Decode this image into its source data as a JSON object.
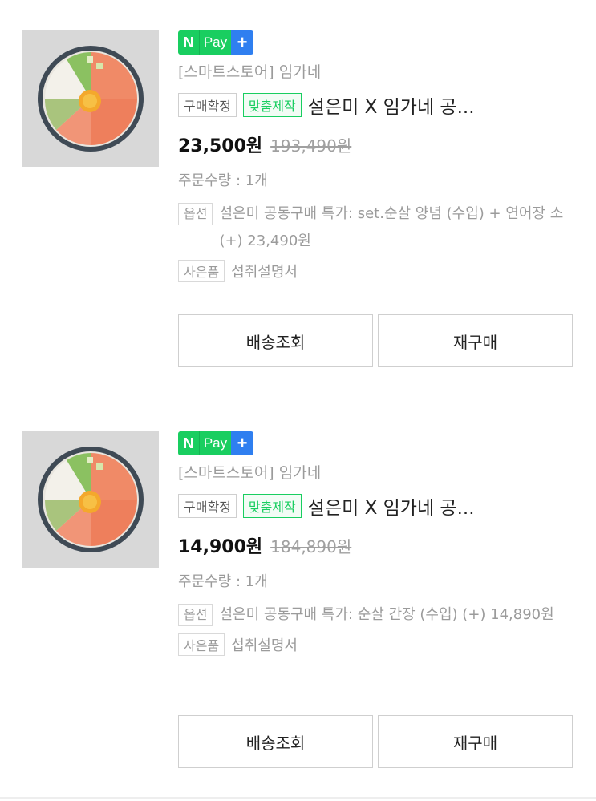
{
  "orders": [
    {
      "npay": {
        "n": "N",
        "pay": "Pay",
        "plus": "+"
      },
      "store": "[스마트스토어] 임가네",
      "status_tag": "구매확정",
      "custom_tag": "맞춤제작",
      "product_name": "설은미 X 임가네 공...",
      "price": "23,500원",
      "original_price": "193,490원",
      "quantity": "주문수량 : 1개",
      "option_label": "옵션",
      "option_text": "설은미 공동구매 특가: set.순살 양념 (수입) + 연어장 소 (+) 23,490원",
      "gift_label": "사은품",
      "gift_text": "섭취설명서",
      "track_button": "배송조회",
      "rebuy_button": "재구매"
    },
    {
      "npay": {
        "n": "N",
        "pay": "Pay",
        "plus": "+"
      },
      "store": "[스마트스토어] 임가네",
      "status_tag": "구매확정",
      "custom_tag": "맞춤제작",
      "product_name": "설은미 X 임가네 공...",
      "price": "14,900원",
      "original_price": "184,890원",
      "quantity": "주문수량 : 1개",
      "option_label": "옵션",
      "option_text": "설은미 공동구매 특가: 순살 간장 (수입) (+) 14,890원",
      "gift_label": "사은품",
      "gift_text": "섭취설명서",
      "track_button": "배송조회",
      "rebuy_button": "재구매"
    }
  ],
  "colors": {
    "npay_green": "#19ce60",
    "npay_blue": "#2f7ff0",
    "custom_tag": "#19ce60",
    "muted_text": "#9b9b9b"
  },
  "icons": [
    "npay-logo",
    "salmon-bowl-thumbnail"
  ]
}
